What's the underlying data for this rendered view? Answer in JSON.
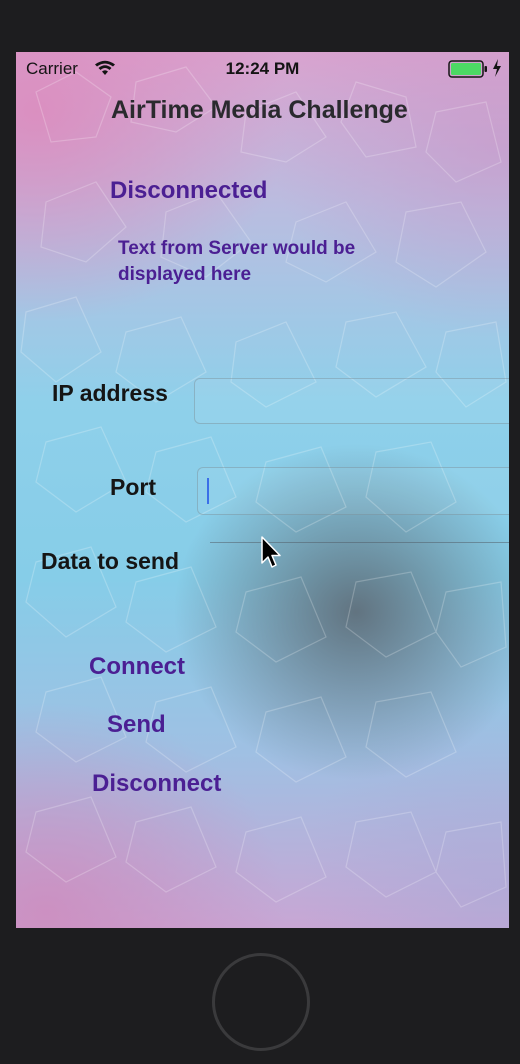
{
  "status_bar": {
    "carrier": "Carrier",
    "time": "12:24 PM",
    "battery_color": "#4cd964"
  },
  "app": {
    "title": "AirTime Media Challenge",
    "connection_status": "Disconnected",
    "server_text": "Text from Server would be displayed here",
    "accent_color": "#4b1f93"
  },
  "form": {
    "ip_label": "IP address",
    "ip_value": "",
    "port_label": "Port",
    "port_value": "",
    "data_label": "Data to send",
    "data_value": ""
  },
  "actions": {
    "connect": "Connect",
    "send": "Send",
    "disconnect": "Disconnect"
  },
  "icons": [
    "wifi-icon",
    "battery-icon",
    "charging-icon",
    "cursor-icon",
    "home-button"
  ]
}
